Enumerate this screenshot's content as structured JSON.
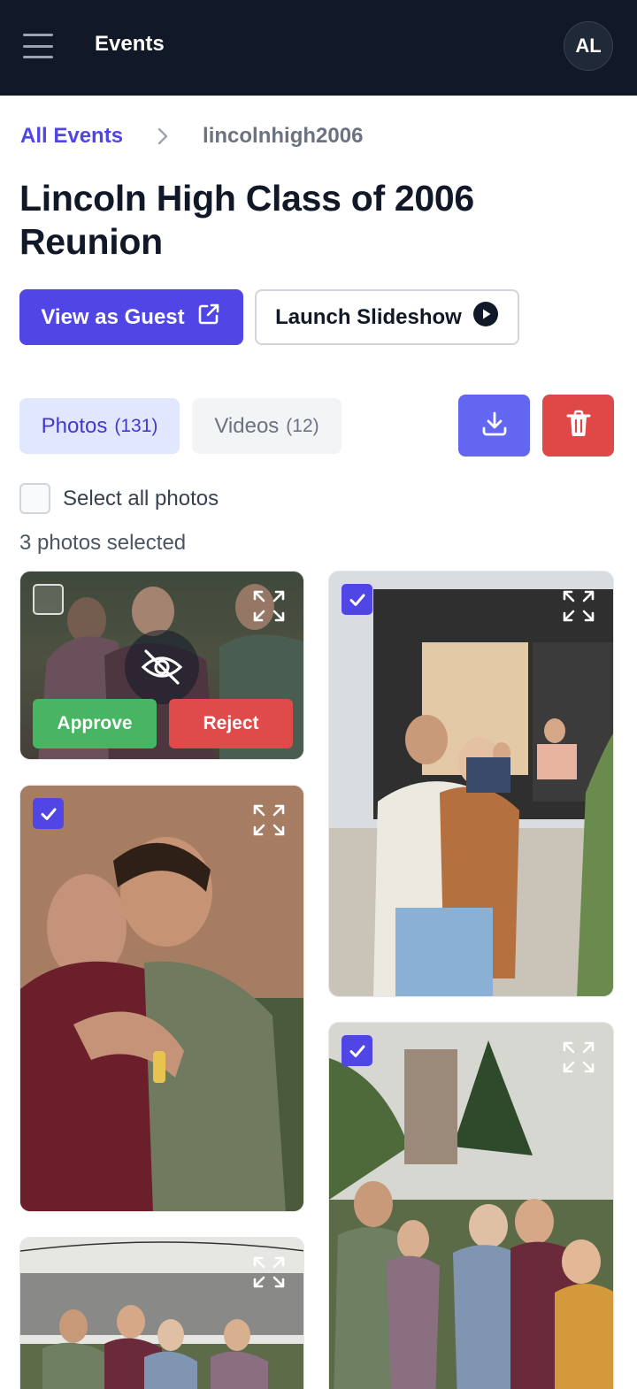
{
  "header": {
    "app_title": "Events",
    "avatar_initials": "AL"
  },
  "breadcrumb": {
    "root": "All Events",
    "current": "lincolnhigh2006"
  },
  "page": {
    "title": "Lincoln High Class of 2006 Reunion"
  },
  "actions": {
    "view_as_guest": "View as Guest",
    "launch_slideshow": "Launch Slideshow"
  },
  "tabs": [
    {
      "label": "Photos",
      "count": "(131)",
      "active": true
    },
    {
      "label": "Videos",
      "count": "(12)",
      "active": false
    }
  ],
  "selection": {
    "select_all_label": "Select all photos",
    "selected_text": "3 photos selected"
  },
  "moderation": {
    "approve_label": "Approve",
    "reject_label": "Reject"
  },
  "photos": [
    {
      "selected": false,
      "pending": true
    },
    {
      "selected": true,
      "pending": false
    },
    {
      "selected": true,
      "pending": false
    },
    {
      "selected": true,
      "pending": false
    },
    {
      "selected": false,
      "pending": false
    }
  ],
  "colors": {
    "primary": "#4f46e5",
    "header_bg": "#111827",
    "approve": "#48b563",
    "reject": "#df4b4b",
    "danger": "#e04848"
  }
}
